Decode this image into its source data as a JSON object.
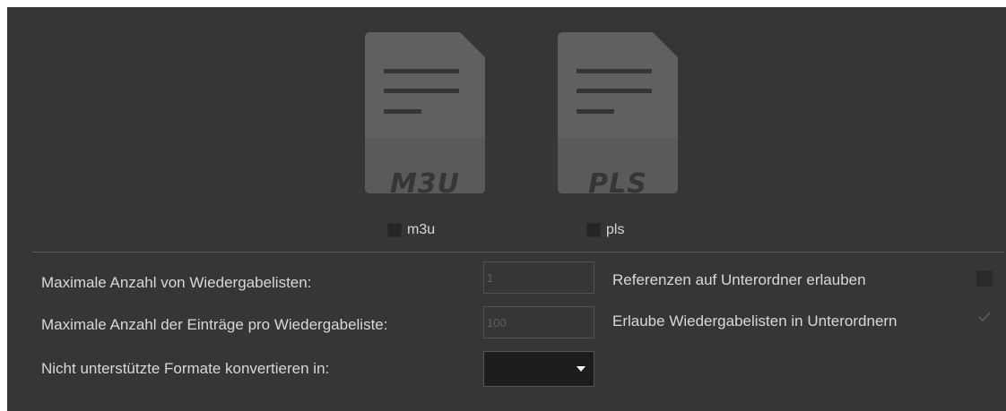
{
  "formats": [
    {
      "icon_text": "M3U",
      "checkbox_label": "m3u",
      "checked": false
    },
    {
      "icon_text": "PLS",
      "checkbox_label": "pls",
      "checked": false
    }
  ],
  "settings": {
    "max_playlists": {
      "label": "Maximale Anzahl von Wiedergabelisten:",
      "placeholder": "1"
    },
    "max_entries": {
      "label": "Maximale Anzahl der Einträge pro Wiedergabeliste:",
      "placeholder": "100"
    },
    "convert_format": {
      "label": "Nicht unterstützte Formate konvertieren in:",
      "selected": ""
    }
  },
  "options": {
    "allow_subfolder_refs": {
      "label": "Referenzen auf Unterordner erlauben",
      "checked": false
    },
    "allow_playlists_in_subfolders": {
      "label": "Erlaube Wiedergabelisten in Unterordnern",
      "checked": true
    }
  },
  "icons": {
    "file_icon": "document-lines-icon",
    "check": "checkmark-icon",
    "caret": "caret-down-icon"
  },
  "colors": {
    "panel_background": "#363636",
    "icon_body": "#606060",
    "icon_band": "#5a5a5a",
    "icon_lines": "#363636",
    "text": "#d8d8d8",
    "select_background": "#1d1d1d"
  }
}
